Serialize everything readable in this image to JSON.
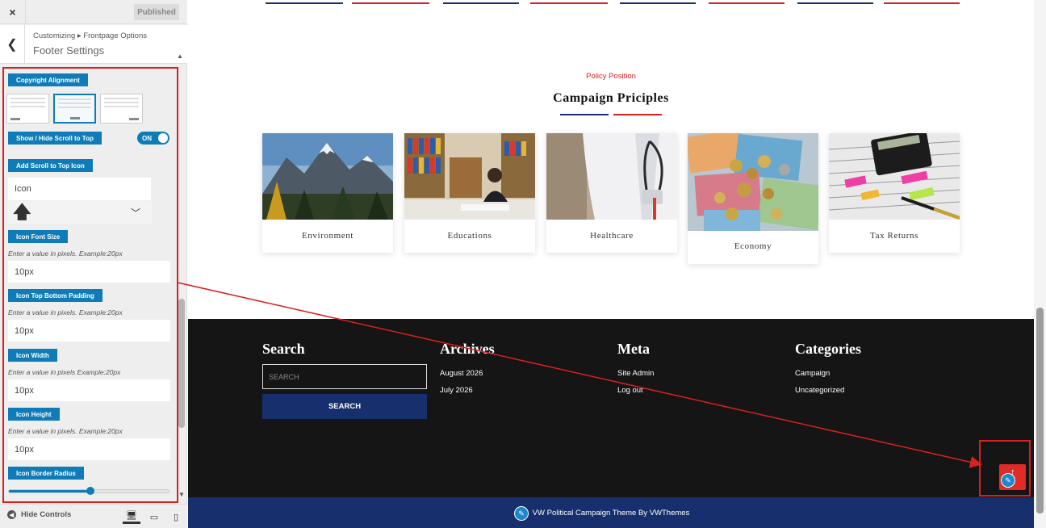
{
  "customizer": {
    "close_icon": "×",
    "publish_label": "Published",
    "breadcrumb": "Customizing ▸ Frontpage Options",
    "section_title": "Footer Settings",
    "copyright_alignment_label": "Copyright Alignment",
    "scroll_toggle_label": "Show / Hide Scroll to Top",
    "scroll_toggle_state": "ON",
    "scroll_icon_label": "Add Scroll to Top Icon",
    "icon_placeholder": "Icon",
    "selected_icon": "arrow-up-icon",
    "font_size_label": "Icon Font Size",
    "font_size_hint": "Enter a value in pixels. Example:20px",
    "font_size_value": "10px",
    "padding_label": "Icon Top Bottom Padding",
    "padding_hint": "Enter a value in pixels. Example:20px",
    "padding_value": "10px",
    "width_label": "Icon Width",
    "width_hint": "Enter a value in pixels Example:20px",
    "width_value": "10px",
    "height_label": "Icon Height",
    "height_hint": "Enter a value in pixels. Example:20px",
    "height_value": "10px",
    "radius_label": "Icon Border Radius",
    "radius_level": 0.51,
    "hide_controls_label": "Hide Controls"
  },
  "preview": {
    "kicker": "Policy Position",
    "title": "Campaign Priciples",
    "cards": [
      {
        "label": "Environment"
      },
      {
        "label": "Educations"
      },
      {
        "label": "Healthcare"
      },
      {
        "label": "Economy"
      },
      {
        "label": "Tax Returns"
      }
    ],
    "footer": {
      "search_title": "Search",
      "search_placeholder": "SEARCH",
      "search_button": "SEARCH",
      "archives_title": "Archives",
      "archives": [
        "August 2026",
        "July 2026"
      ],
      "meta_title": "Meta",
      "meta": [
        "Site Admin",
        "Log out"
      ],
      "categories_title": "Categories",
      "categories": [
        "Campaign",
        "Uncategorized"
      ]
    },
    "copyright": "VW Political Campaign Theme By VWThemes"
  },
  "colors": {
    "accent_blue": "#0f7cb8",
    "navy": "#17306d",
    "red": "#d8201f",
    "footer_bg": "#151515"
  }
}
